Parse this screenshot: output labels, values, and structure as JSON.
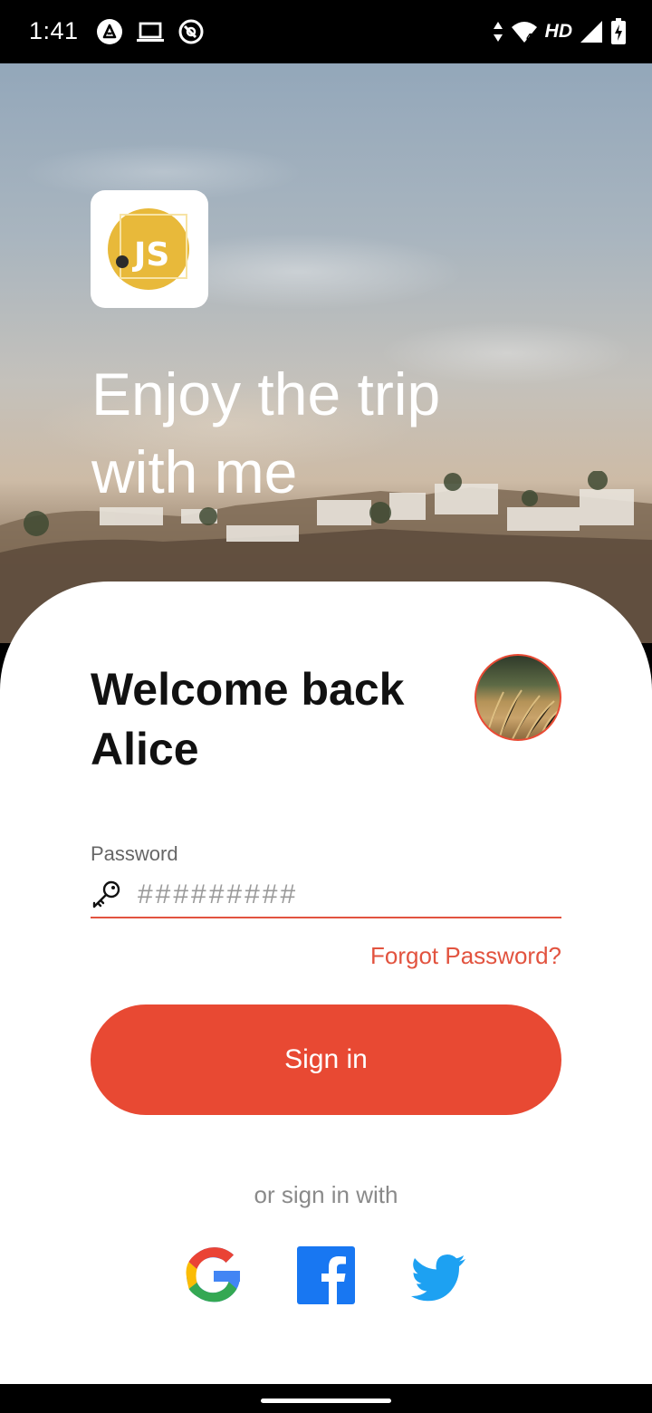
{
  "status_bar": {
    "time": "1:41",
    "left_icons": [
      "a-icon",
      "laptop-icon",
      "vpn-icon"
    ],
    "right_icons": [
      "data-arrows-icon",
      "wifi-icon",
      "signal-icon",
      "battery-charging-icon"
    ],
    "network_label": "HD",
    "wifi_badge": "4"
  },
  "hero": {
    "logo_text": "JS",
    "title_line1": "Enjoy the trip",
    "title_line2": "with me"
  },
  "login": {
    "welcome_line1": "Welcome back",
    "welcome_line2": "Alice",
    "password_label": "Password",
    "password_placeholder": "#########",
    "forgot_label": "Forgot Password?",
    "signin_label": "Sign in",
    "or_label": "or sign in with"
  },
  "social": [
    "google-icon",
    "facebook-icon",
    "twitter-icon"
  ],
  "colors": {
    "accent": "#e84933",
    "logo_yellow": "#e8b93a",
    "facebook": "#1877f2",
    "twitter": "#1da1f2"
  }
}
